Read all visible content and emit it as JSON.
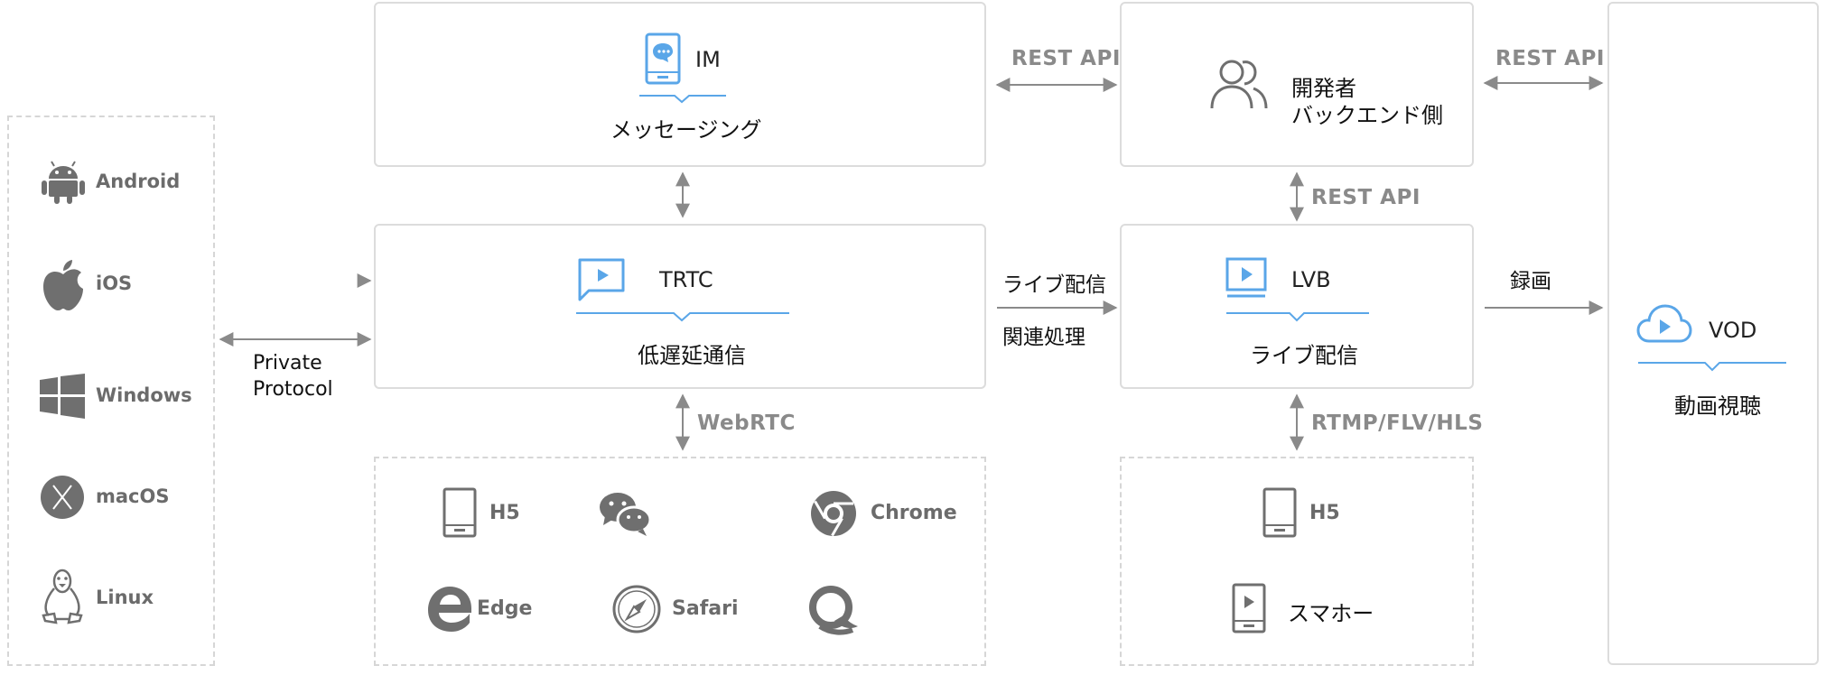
{
  "platforms": {
    "android": "Android",
    "ios": "iOS",
    "windows": "Windows",
    "macos": "macOS",
    "linux": "Linux"
  },
  "private_protocol": {
    "line1": "Private",
    "line2": "Protocol"
  },
  "im": {
    "title": "IM",
    "subtitle": "メッセージング"
  },
  "trtc": {
    "title": "TRTC",
    "subtitle": "低遅延通信"
  },
  "developer": {
    "line1": "開発者",
    "line2": "バックエンド側"
  },
  "lvb": {
    "title": "LVB",
    "subtitle": "ライブ配信"
  },
  "vod": {
    "title": "VOD",
    "subtitle": "動画視聴"
  },
  "connections": {
    "im_dev": "REST API",
    "dev_vod": "REST API",
    "dev_lvb": "REST API",
    "trtc_lvb_1": "ライブ配信",
    "trtc_lvb_2": "関連処理",
    "lvb_vod": "録画",
    "trtc_web": "WebRTC",
    "lvb_players": "RTMP/FLV/HLS"
  },
  "web_clients": {
    "h5": "H5",
    "chrome": "Chrome",
    "edge": "Edge",
    "safari": "Safari"
  },
  "lvb_clients": {
    "h5": "H5",
    "smartphone": "スマホー"
  },
  "colors": {
    "accent": "#5aa6e8",
    "icon_gray": "#6f6f6f",
    "border": "#dcdcdc",
    "arrow": "#8a8a8a"
  }
}
